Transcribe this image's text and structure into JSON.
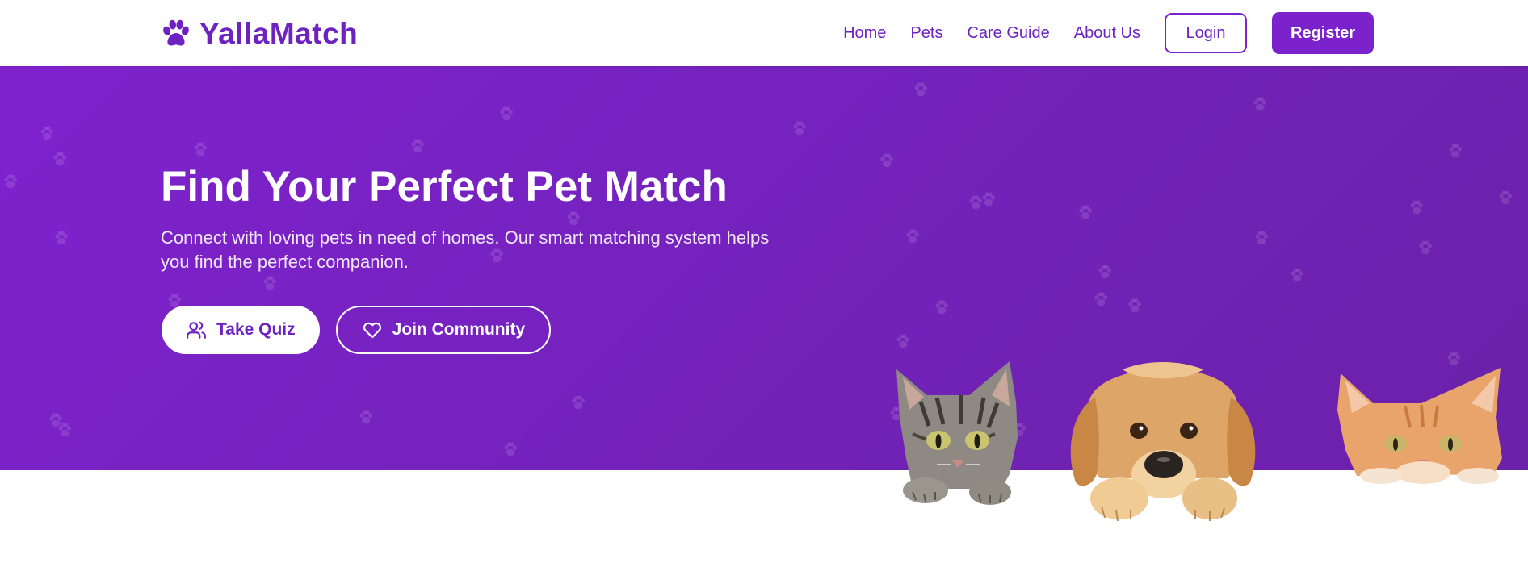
{
  "brand": {
    "name": "YallaMatch",
    "logo_icon": "paw-icon",
    "color": "#6d22c2"
  },
  "nav": {
    "links": [
      "Home",
      "Pets",
      "Care Guide",
      "About Us"
    ],
    "login_label": "Login",
    "register_label": "Register"
  },
  "hero": {
    "title": "Find Your Perfect Pet Match",
    "subtitle": "Connect with loving pets in need of homes. Our smart matching system helps you find the perfect companion.",
    "primary_button": {
      "label": "Take Quiz",
      "icon": "users-icon"
    },
    "secondary_button": {
      "label": "Join Community",
      "icon": "heart-icon"
    },
    "background_color": "#7e22ce",
    "pets_image": [
      "cat",
      "dog",
      "kitten"
    ]
  }
}
